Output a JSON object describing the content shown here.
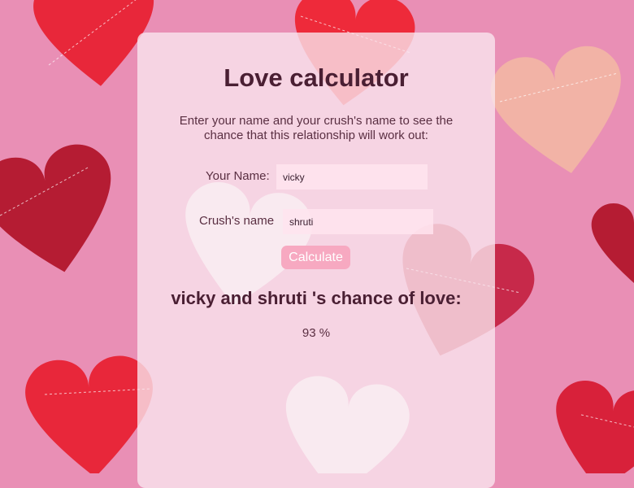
{
  "page": {
    "title": "Love calculator",
    "intro": "Enter your name and your crush's name to see the chance that this relationship will work out:"
  },
  "form": {
    "name_label": "Your Name:",
    "name_value": "vicky",
    "crush_label": "Crush's name",
    "crush_value": "shruti",
    "calculate_label": "Calculate"
  },
  "result": {
    "heading": "vicky and shruti 's chance of love:",
    "value": "93 %"
  },
  "colors": {
    "background": "#e98fb5",
    "heart_red": "#e8273a",
    "heart_dark_red": "#b51c33",
    "heart_pink": "#f2b3a6",
    "heart_white": "#f7f1f0",
    "button": "#f7a9c1"
  }
}
